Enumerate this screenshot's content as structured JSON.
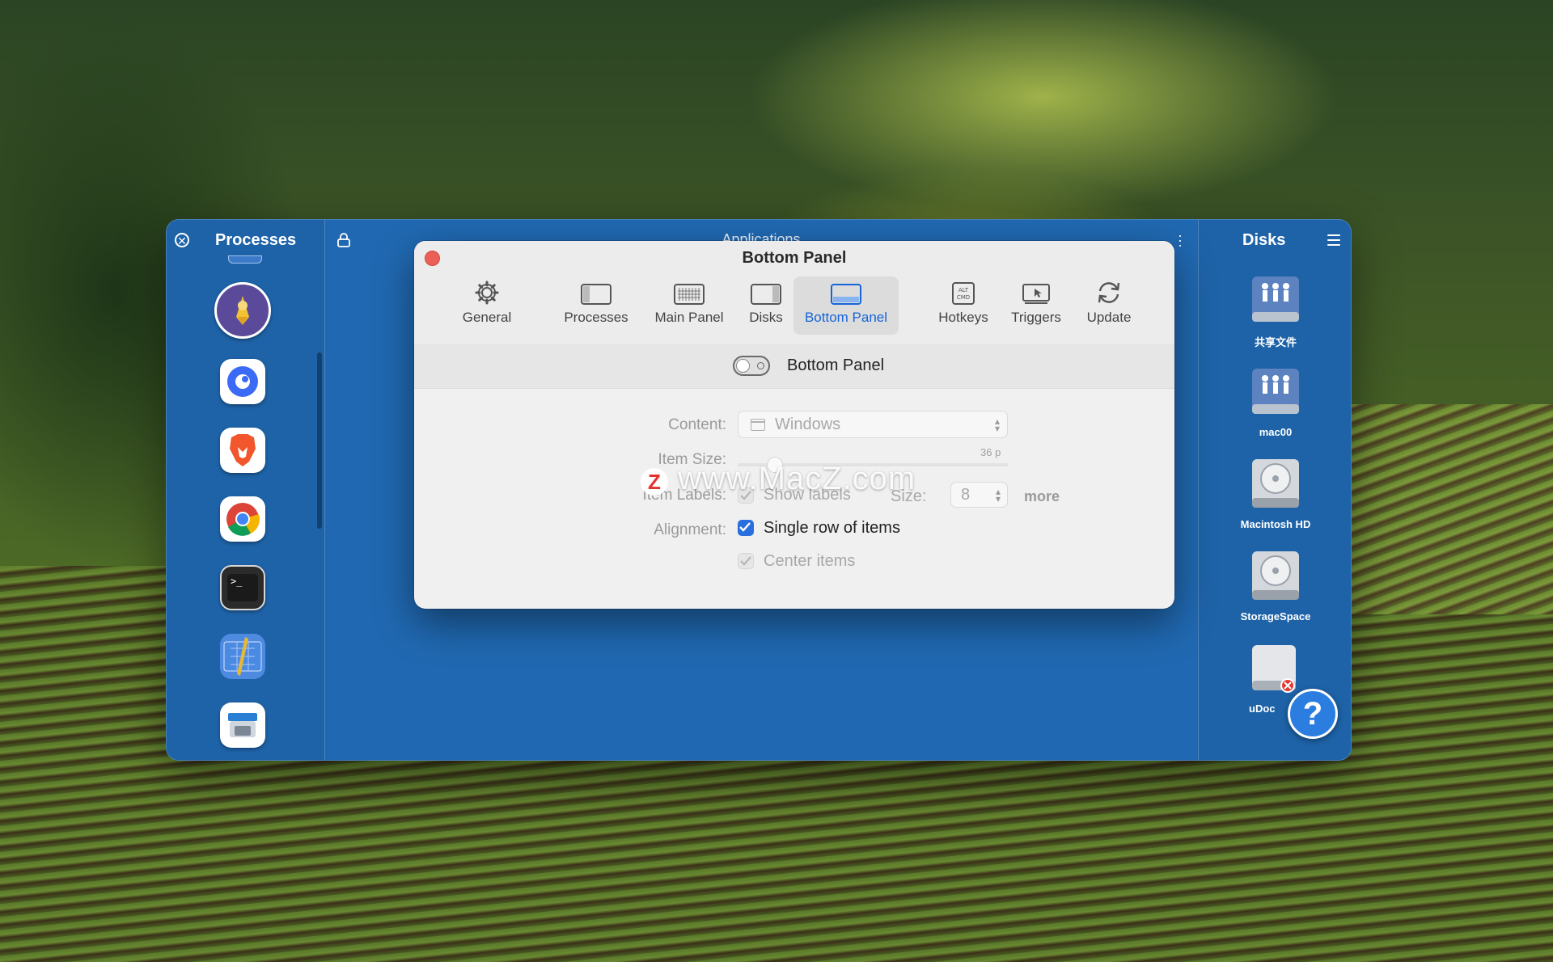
{
  "processes_pane": {
    "title": "Processes"
  },
  "center_pane": {
    "title": "Applications"
  },
  "disks_pane": {
    "title": "Disks",
    "disks": [
      {
        "name": "共享文件",
        "type": "network"
      },
      {
        "name": "mac00",
        "type": "network"
      },
      {
        "name": "Macintosh HD",
        "type": "internal"
      },
      {
        "name": "StorageSpace",
        "type": "internal"
      },
      {
        "name": "uDoc",
        "type": "removable"
      }
    ]
  },
  "dialog": {
    "title": "Bottom Panel",
    "tabs": [
      {
        "label": "General",
        "icon": "gear-icon"
      },
      {
        "label": "Processes",
        "icon": "sidebar-left-icon"
      },
      {
        "label": "Main Panel",
        "icon": "grid-panel-icon"
      },
      {
        "label": "Disks",
        "icon": "sidebar-right-icon"
      },
      {
        "label": "Bottom Panel",
        "icon": "bottom-panel-icon",
        "active": true
      },
      {
        "label": "Hotkeys",
        "icon": "alt-cmd-key-icon"
      },
      {
        "label": "Triggers",
        "icon": "cursor-screen-icon"
      },
      {
        "label": "Update",
        "icon": "refresh-icon"
      }
    ],
    "toggle": {
      "label": "Bottom Panel",
      "on": false
    },
    "form": {
      "content_label": "Content:",
      "content_value": "Windows",
      "item_size_label": "Item Size:",
      "item_size_value": "36 p",
      "item_labels_label": "Item Labels:",
      "show_labels": "Show labels",
      "size_label": "Size:",
      "size_value": "8",
      "more": "more",
      "alignment_label": "Alignment:",
      "single_row": "Single row of items",
      "center_items": "Center items"
    }
  },
  "watermark": {
    "text": "www.MacZ.com",
    "logo_letter": "Z"
  },
  "help_button": {
    "label": "?"
  }
}
